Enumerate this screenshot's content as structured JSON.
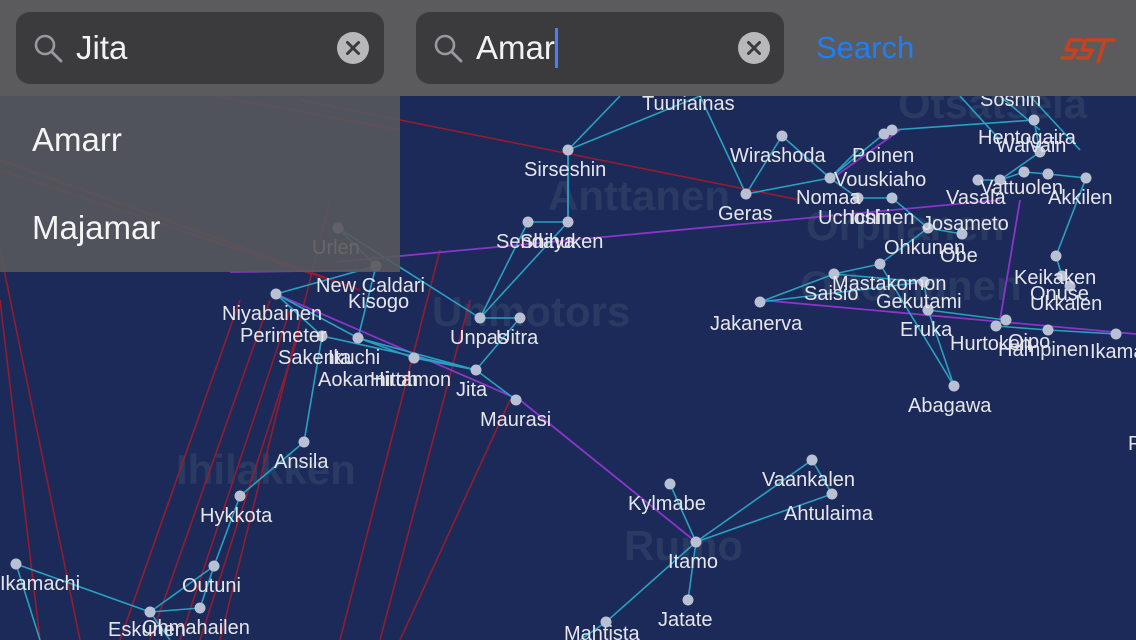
{
  "search": {
    "origin_value": "Jita",
    "destination_value": "Amar",
    "button_label": "Search"
  },
  "suggestions": [
    "Amarr",
    "Majamar"
  ],
  "map": {
    "regions": [
      "Ihilakken",
      "Rumo",
      "Anttanen",
      "Otsatsela",
      "Orphanen",
      "Ottomanen",
      "Unmotors"
    ],
    "systems": [
      "Tuuriainas",
      "Soshin",
      "Hentogaira",
      "Walvain",
      "Wirashoda",
      "Poinen",
      "Perimeter",
      "Sirseshin",
      "Vouskiaho",
      "Nomaa",
      "Geras",
      "Uchoshi",
      "Josameto",
      "Ichinen",
      "Akkilen",
      "Urlen",
      "Sendaya",
      "Obe",
      "Niyabainen",
      "New Caldari",
      "Kisogo",
      "Ohkunen",
      "Keikaken",
      "Onuse",
      "Ukkalen",
      "Saisio",
      "Mastakomon",
      "Gekutami",
      "Jakanerva",
      "Eruka",
      "Uitra",
      "Unpas",
      "Hurtoken",
      "Hampinen",
      "Ikama",
      "Oipo",
      "Sakenta",
      "Ikuchi",
      "Aokannitoh",
      "Hirtamon",
      "Jita",
      "Maurasi",
      "Abagawa",
      "Ansila",
      "Vaankalen",
      "Kylmabe",
      "Ahtulaima",
      "Hykkota",
      "Itamo",
      "Outuni",
      "Jatate",
      "Eskunen",
      "Ohmahailen",
      "Mahtista",
      "Ikamachi",
      "Vattuolen",
      "Vasala",
      "Shihuken",
      "Poikeni"
    ],
    "labels": [
      {
        "name": "Tuuriainas"
      },
      {
        "name": "Soshin"
      },
      {
        "name": "Hentogaira"
      },
      {
        "name": "Walvain"
      },
      {
        "name": "Wirashoda"
      },
      {
        "name": "Poinen"
      },
      {
        "name": "Sirseshin"
      },
      {
        "name": "Vouskiaho"
      },
      {
        "name": "Nomaa"
      },
      {
        "name": "Geras"
      },
      {
        "name": "Uchoshi"
      },
      {
        "name": "Ichinen"
      },
      {
        "name": "Josameto"
      },
      {
        "name": "Vattuolen"
      },
      {
        "name": "Vasala"
      },
      {
        "name": "Akkilen"
      },
      {
        "name": "Urlen"
      },
      {
        "name": "Sendaya"
      },
      {
        "name": "Shihuken"
      },
      {
        "name": "Ohkunen"
      },
      {
        "name": "Obe"
      },
      {
        "name": "New Caldari"
      },
      {
        "name": "Kisogo"
      },
      {
        "name": "Keikaken"
      },
      {
        "name": "Onuse"
      },
      {
        "name": "Ukkalen"
      },
      {
        "name": "Niyabainen"
      },
      {
        "name": "Mastakomon"
      },
      {
        "name": "Saisio"
      },
      {
        "name": "Gekutami"
      },
      {
        "name": "Perimeter"
      },
      {
        "name": "Unpas"
      },
      {
        "name": "Uitra"
      },
      {
        "name": "Jakanerva"
      },
      {
        "name": "Eruka"
      },
      {
        "name": "Hurtoken"
      },
      {
        "name": "Oipo"
      },
      {
        "name": "Hampinen"
      },
      {
        "name": "Ikama"
      },
      {
        "name": "Sakenta"
      },
      {
        "name": "Ikuchi"
      },
      {
        "name": "Aokannitoh"
      },
      {
        "name": "Hirtamon"
      },
      {
        "name": "Jita"
      },
      {
        "name": "Maurasi"
      },
      {
        "name": "Abagawa"
      },
      {
        "name": "Ansila"
      },
      {
        "name": "Vaankalen"
      },
      {
        "name": "Kylmabe"
      },
      {
        "name": "Ahtulaima"
      },
      {
        "name": "Hykkota"
      },
      {
        "name": "Itamo"
      },
      {
        "name": "Outuni"
      },
      {
        "name": "Jatate"
      },
      {
        "name": "Eskunen"
      },
      {
        "name": "Ohmahailen"
      },
      {
        "name": "Mahtista"
      },
      {
        "name": "Ikamachi"
      }
    ]
  },
  "colors": {
    "background": "#1b2a59",
    "gate_link": "#2aa0c0",
    "constellation_link": "#8a35c9",
    "region_link": "#a01b2b",
    "system_node": "#b9c0d3",
    "system_label": "#e6e6ea",
    "region_label": "#2a3b63",
    "search_accent": "#1f7ef5",
    "logo": "#c9421f"
  }
}
